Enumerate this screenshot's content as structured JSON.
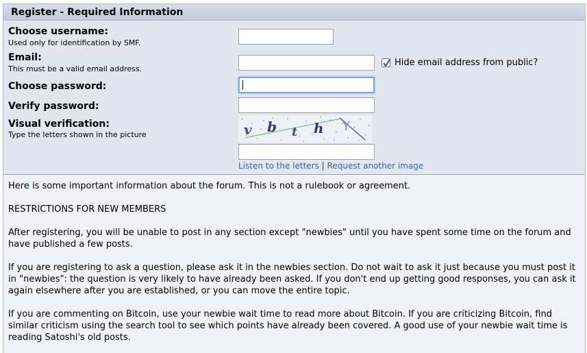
{
  "header": {
    "title": "Register - Required Information"
  },
  "form": {
    "username_label": "Choose username:",
    "username_hint": "Used only for identification by SMF.",
    "email_label": "Email:",
    "email_hint": "This must be a valid email address.",
    "hide_email_label": "Hide email address from public?",
    "hide_email_checked": true,
    "password_label": "Choose password:",
    "verify_label": "Verify password:",
    "visual_label": "Visual verification:",
    "visual_hint": "Type the letters shown in the picture",
    "captcha_letters": [
      "v",
      "b",
      "t",
      "h",
      "Y"
    ],
    "listen_link": "Listen to the letters",
    "separator": "|",
    "request_link": "Request another image"
  },
  "info": {
    "paragraphs": [
      "Here is some important information about the forum. This is not a rulebook or agreement.",
      "RESTRICTIONS FOR NEW MEMBERS",
      "After registering, you will be unable to post in any section except \"newbies\" until you have spent some time on the forum and have published a few posts.",
      "If you are registering to ask a question, please ask it in the newbies section. Do not wait to ask it just because you must post it in \"newbies\": the question is very likely to have already been asked. If you don't end up getting good responses, you can ask it again elsewhere after you are established, or you can move the entire topic.",
      "If you are commenting on Bitcoin, use your newbie wait time to read more about Bitcoin. If you are criticizing Bitcoin, find similar criticism using the search tool to see which points have already been covered. A good use of your newbie wait time is reading Satoshi's old posts."
    ]
  },
  "colors": {
    "link": "#3a62a3",
    "focus": "#7fa8d8",
    "panel": "#e1e6ef"
  }
}
